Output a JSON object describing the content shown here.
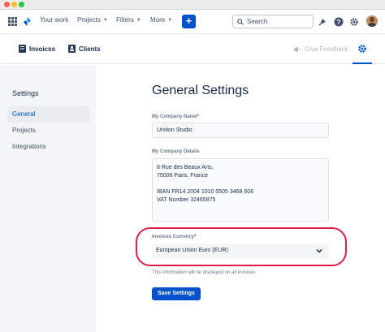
{
  "colors": {
    "primary": "#0052cc",
    "sidebar_bg": "#f4f5f7",
    "highlight": "#e11d48",
    "required": "#de350b"
  },
  "topnav": {
    "items": [
      {
        "label": "Your work",
        "has_dropdown": false
      },
      {
        "label": "Projects",
        "has_dropdown": true
      },
      {
        "label": "Filters",
        "has_dropdown": true
      },
      {
        "label": "More",
        "has_dropdown": true
      }
    ],
    "create_label": "+",
    "search_label": "Search",
    "icons": [
      "apps-grid-icon",
      "product-logo-icon",
      "notification-icon",
      "help-icon",
      "settings-icon",
      "avatar"
    ]
  },
  "subnav": {
    "invoices_label": "Invoices",
    "clients_label": "Clients",
    "feedback_label": "Give Feedback"
  },
  "sidebar": {
    "heading": "Settings",
    "items": [
      {
        "label": "General",
        "active": true
      },
      {
        "label": "Projects",
        "active": false
      },
      {
        "label": "Integrations",
        "active": false
      }
    ]
  },
  "main": {
    "title": "General Settings",
    "company_name": {
      "label": "My Company Name",
      "required": "*",
      "value": "Unition Studio"
    },
    "company_details": {
      "label": "My Company Details",
      "lines": [
        "8 Rue des Beaux Arts,",
        "75006 Paris, France",
        "",
        "IBAN FR14 2004 1010 0505 3468 606",
        "VAT Number 32465875"
      ]
    },
    "currency": {
      "label": "Invoices Currency",
      "required": "*",
      "value": "European Union Euro (EUR)",
      "help": "This information will be displayed on all invoices"
    },
    "save_label": "Save Settings"
  }
}
